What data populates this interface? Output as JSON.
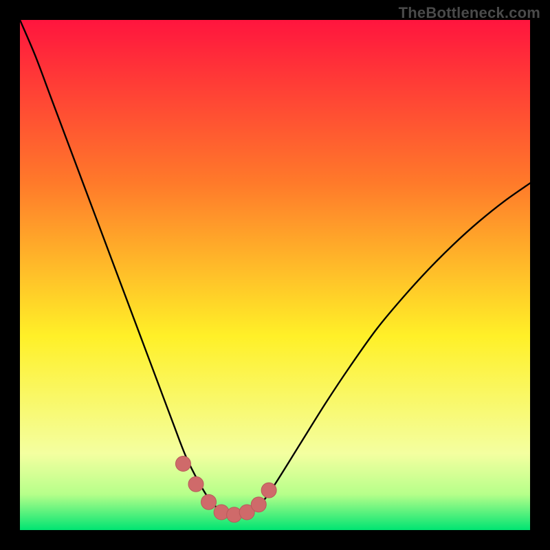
{
  "watermark": "TheBottleneck.com",
  "colors": {
    "background_black": "#000000",
    "gradient_top": "#ff153e",
    "gradient_mid1": "#ff7a2a",
    "gradient_mid2": "#fff028",
    "gradient_bottom": "#00e472",
    "curve_stroke": "#000000",
    "marker_fill": "#cf6a6a",
    "marker_stroke": "#b85a5a"
  },
  "chart_data": {
    "type": "line",
    "title": "",
    "xlabel": "",
    "ylabel": "",
    "xlim": [
      0,
      1
    ],
    "ylim": [
      0,
      1
    ],
    "note": "No axes or tick labels visible; x and y are normalized fractions of the plot area. y=1 corresponds to the top (red / high bottleneck), y≈0 to the bottom (green / low bottleneck). The curve dips to ~0.03 around x≈0.36–0.45 then rises again.",
    "series": [
      {
        "name": "bottleneck-curve",
        "x": [
          0.0,
          0.03,
          0.06,
          0.09,
          0.12,
          0.15,
          0.18,
          0.21,
          0.24,
          0.27,
          0.3,
          0.325,
          0.35,
          0.375,
          0.4,
          0.425,
          0.45,
          0.475,
          0.5,
          0.55,
          0.6,
          0.65,
          0.7,
          0.75,
          0.8,
          0.85,
          0.9,
          0.95,
          1.0
        ],
        "y": [
          1.0,
          0.93,
          0.85,
          0.77,
          0.69,
          0.61,
          0.53,
          0.45,
          0.37,
          0.29,
          0.21,
          0.145,
          0.095,
          0.055,
          0.035,
          0.03,
          0.035,
          0.055,
          0.09,
          0.17,
          0.25,
          0.325,
          0.395,
          0.455,
          0.51,
          0.56,
          0.605,
          0.645,
          0.68
        ]
      }
    ],
    "markers": {
      "name": "highlighted-points",
      "x": [
        0.32,
        0.345,
        0.37,
        0.395,
        0.42,
        0.445,
        0.468,
        0.488
      ],
      "y": [
        0.13,
        0.09,
        0.055,
        0.035,
        0.03,
        0.035,
        0.05,
        0.078
      ]
    }
  }
}
